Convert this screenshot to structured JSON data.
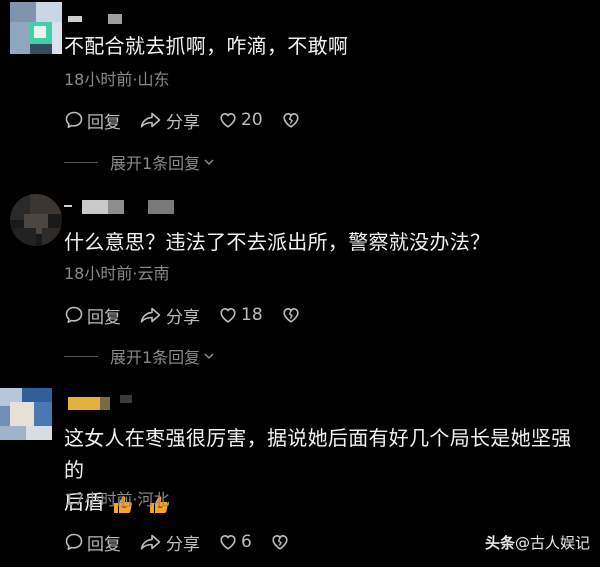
{
  "comments": [
    {
      "text": "不配合就去抓啊，咋滴，不敢啊",
      "meta": "18小时前·山东",
      "reply_label": "回复",
      "share_label": "分享",
      "like_count": "20",
      "expand_label": "展开1条回复"
    },
    {
      "text": "什么意思？违法了不去派出所，警察就没办法？",
      "meta": "18小时前·云南",
      "reply_label": "回复",
      "share_label": "分享",
      "like_count": "18",
      "expand_label": "展开1条回复"
    },
    {
      "text_line1": "这女人在枣强很厉害，据说她后面有好几个局长是她坚强的",
      "text_line2": "后盾",
      "meta": "17小时前·河北",
      "reply_label": "回复",
      "share_label": "分享",
      "like_count": "6"
    }
  ],
  "icons": {
    "reply": "comment-bubble-icon",
    "share": "share-arrow-icon",
    "like": "heart-icon",
    "dislike": "broken-heart-icon",
    "expand": "chevron-down-icon",
    "emoji": "thumbs-up-emoji"
  },
  "colors": {
    "background": "#000000",
    "text": "#f2f2f2",
    "meta": "#8a8a8a",
    "action": "#bdbdbd",
    "emoji": "#f5a623"
  },
  "watermark": {
    "brand": "头条",
    "handle": "@古人娱记"
  }
}
